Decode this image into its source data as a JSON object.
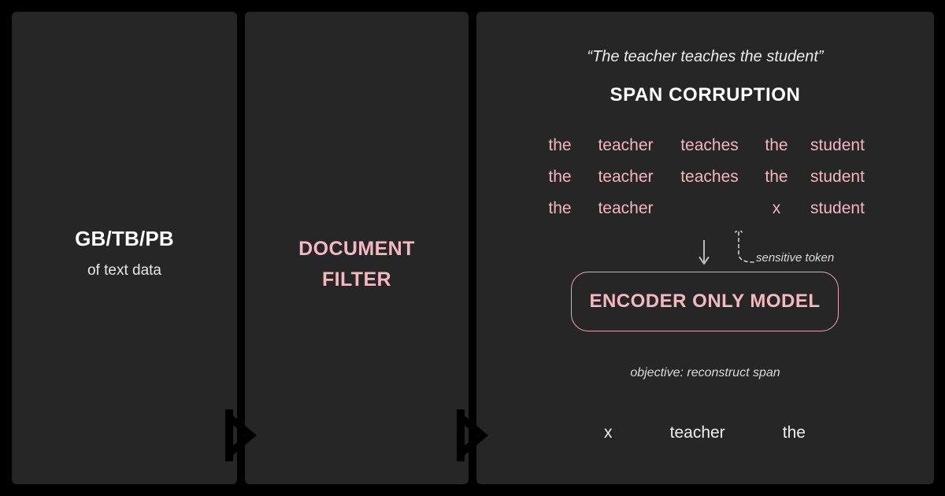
{
  "theme": {
    "background": "#000000",
    "panel_background": "#262626",
    "accent_pink": "#f4b8c3",
    "text_white": "#ffffff",
    "text_muted": "#d9d9d9"
  },
  "panels": [
    {
      "id": "data-volume",
      "title": "GB/TB/PB",
      "subtitle": "of text data"
    },
    {
      "id": "document-filter",
      "title_line_1": "DOCUMENT",
      "title_line_2": "FILTER"
    },
    {
      "id": "span-corruption",
      "quote": "“The teacher teaches the student”",
      "heading": "SPAN CORRUPTION",
      "token_rows": [
        [
          "the",
          "teacher",
          "teaches",
          "the",
          "student"
        ],
        [
          "the",
          "teacher",
          "teaches",
          "the",
          "student"
        ],
        [
          "the",
          "teacher",
          "",
          "x",
          "student"
        ]
      ],
      "sensitive_label": "sensitive token",
      "encoder_label": "ENCODER ONLY MODEL",
      "objective": "objective: reconstruct span",
      "output_tokens": [
        "x",
        "teacher",
        "the"
      ]
    }
  ],
  "icons": {
    "chevron_separator": "chevron-right-icon",
    "down_arrow": "arrow-down-icon",
    "dashed_callout_arrow": "dashed-arrow-up-icon"
  }
}
